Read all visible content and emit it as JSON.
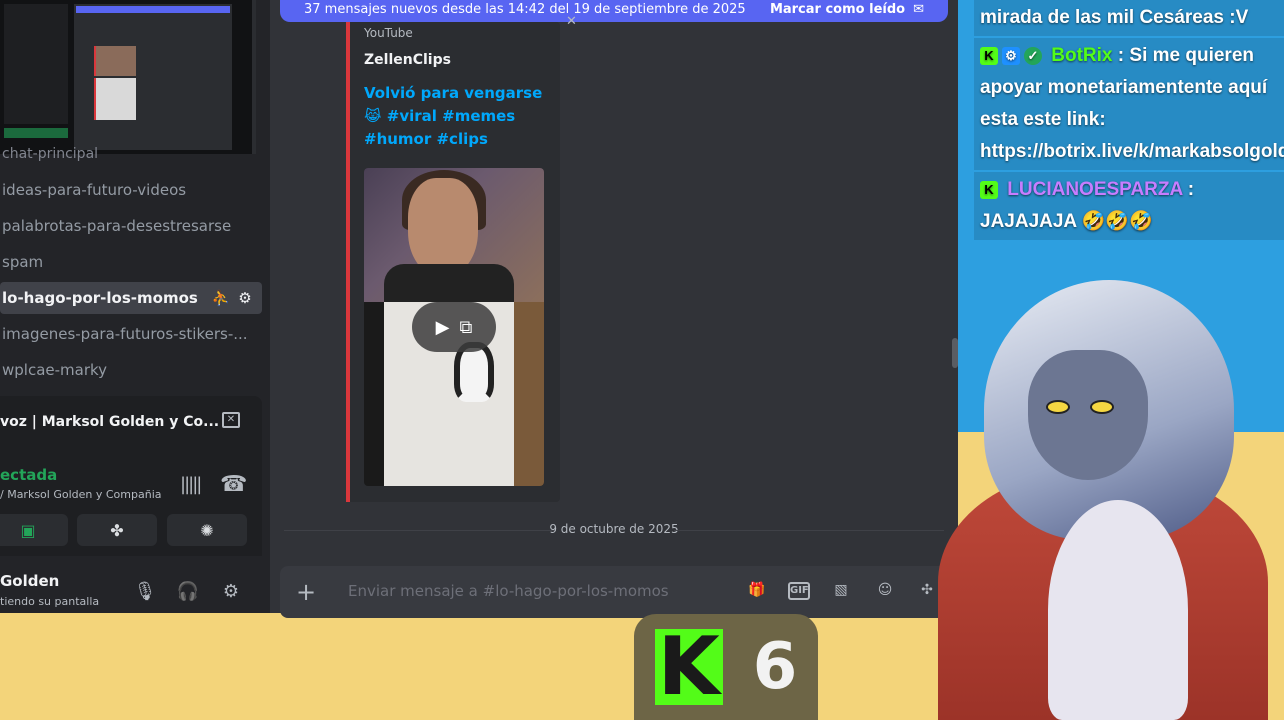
{
  "sidebar": {
    "partial_channel": "chat-principal",
    "channels": [
      {
        "label": "ideas-para-futuro-videos",
        "active": false
      },
      {
        "label": "palabrotas-para-desestresarse",
        "active": false
      },
      {
        "label": "spam",
        "active": false
      },
      {
        "label": "lo-hago-por-los-momos",
        "active": true
      },
      {
        "label": "imagenes-para-futuros-stikers-...",
        "active": false
      },
      {
        "label": "wplcae-marky",
        "active": false
      }
    ],
    "voice": {
      "title": "voz | Marksol Golden y Co...",
      "status": "ectada",
      "sub": "/ Marksol Golden y Compañia"
    },
    "user": {
      "name": "Golden",
      "status": "tiendo su pantalla"
    }
  },
  "chat": {
    "new_messages_text": "37 mensajes nuevos desde las 14:42 del 19 de septiembre de 2025",
    "mark_read_label": "Marcar como leído",
    "embed": {
      "provider": "YouTube",
      "author": "ZellenClips",
      "title": "Volvió para vengarse 😹 #viral #memes #humor #clips"
    },
    "date_divider": "9 de octubre de 2025",
    "input_placeholder": "Enviar mensaje a #lo-hago-por-los-momos"
  },
  "stream_chat": {
    "messages": [
      {
        "user": "",
        "text": "mirada de las mil Cesáreas :V"
      },
      {
        "user": "BotRix",
        "text": " Si me quieren apoyar monetariamentente aquí esta este link: https://botrix.live/k/markabsolgold/tip"
      },
      {
        "user": "LUCIANOESPARZA",
        "text": " JAJAJAJA 🤣🤣🤣"
      }
    ]
  },
  "kick_widget": {
    "logo": "K",
    "count": "6"
  },
  "colors": {
    "discord_blurple": "#5865f2",
    "discord_bg": "#313338",
    "link_blue": "#00a8fc",
    "kick_green": "#53fc18",
    "stream_blue": "#2d9fe0",
    "stream_yellow": "#f3d47a"
  }
}
